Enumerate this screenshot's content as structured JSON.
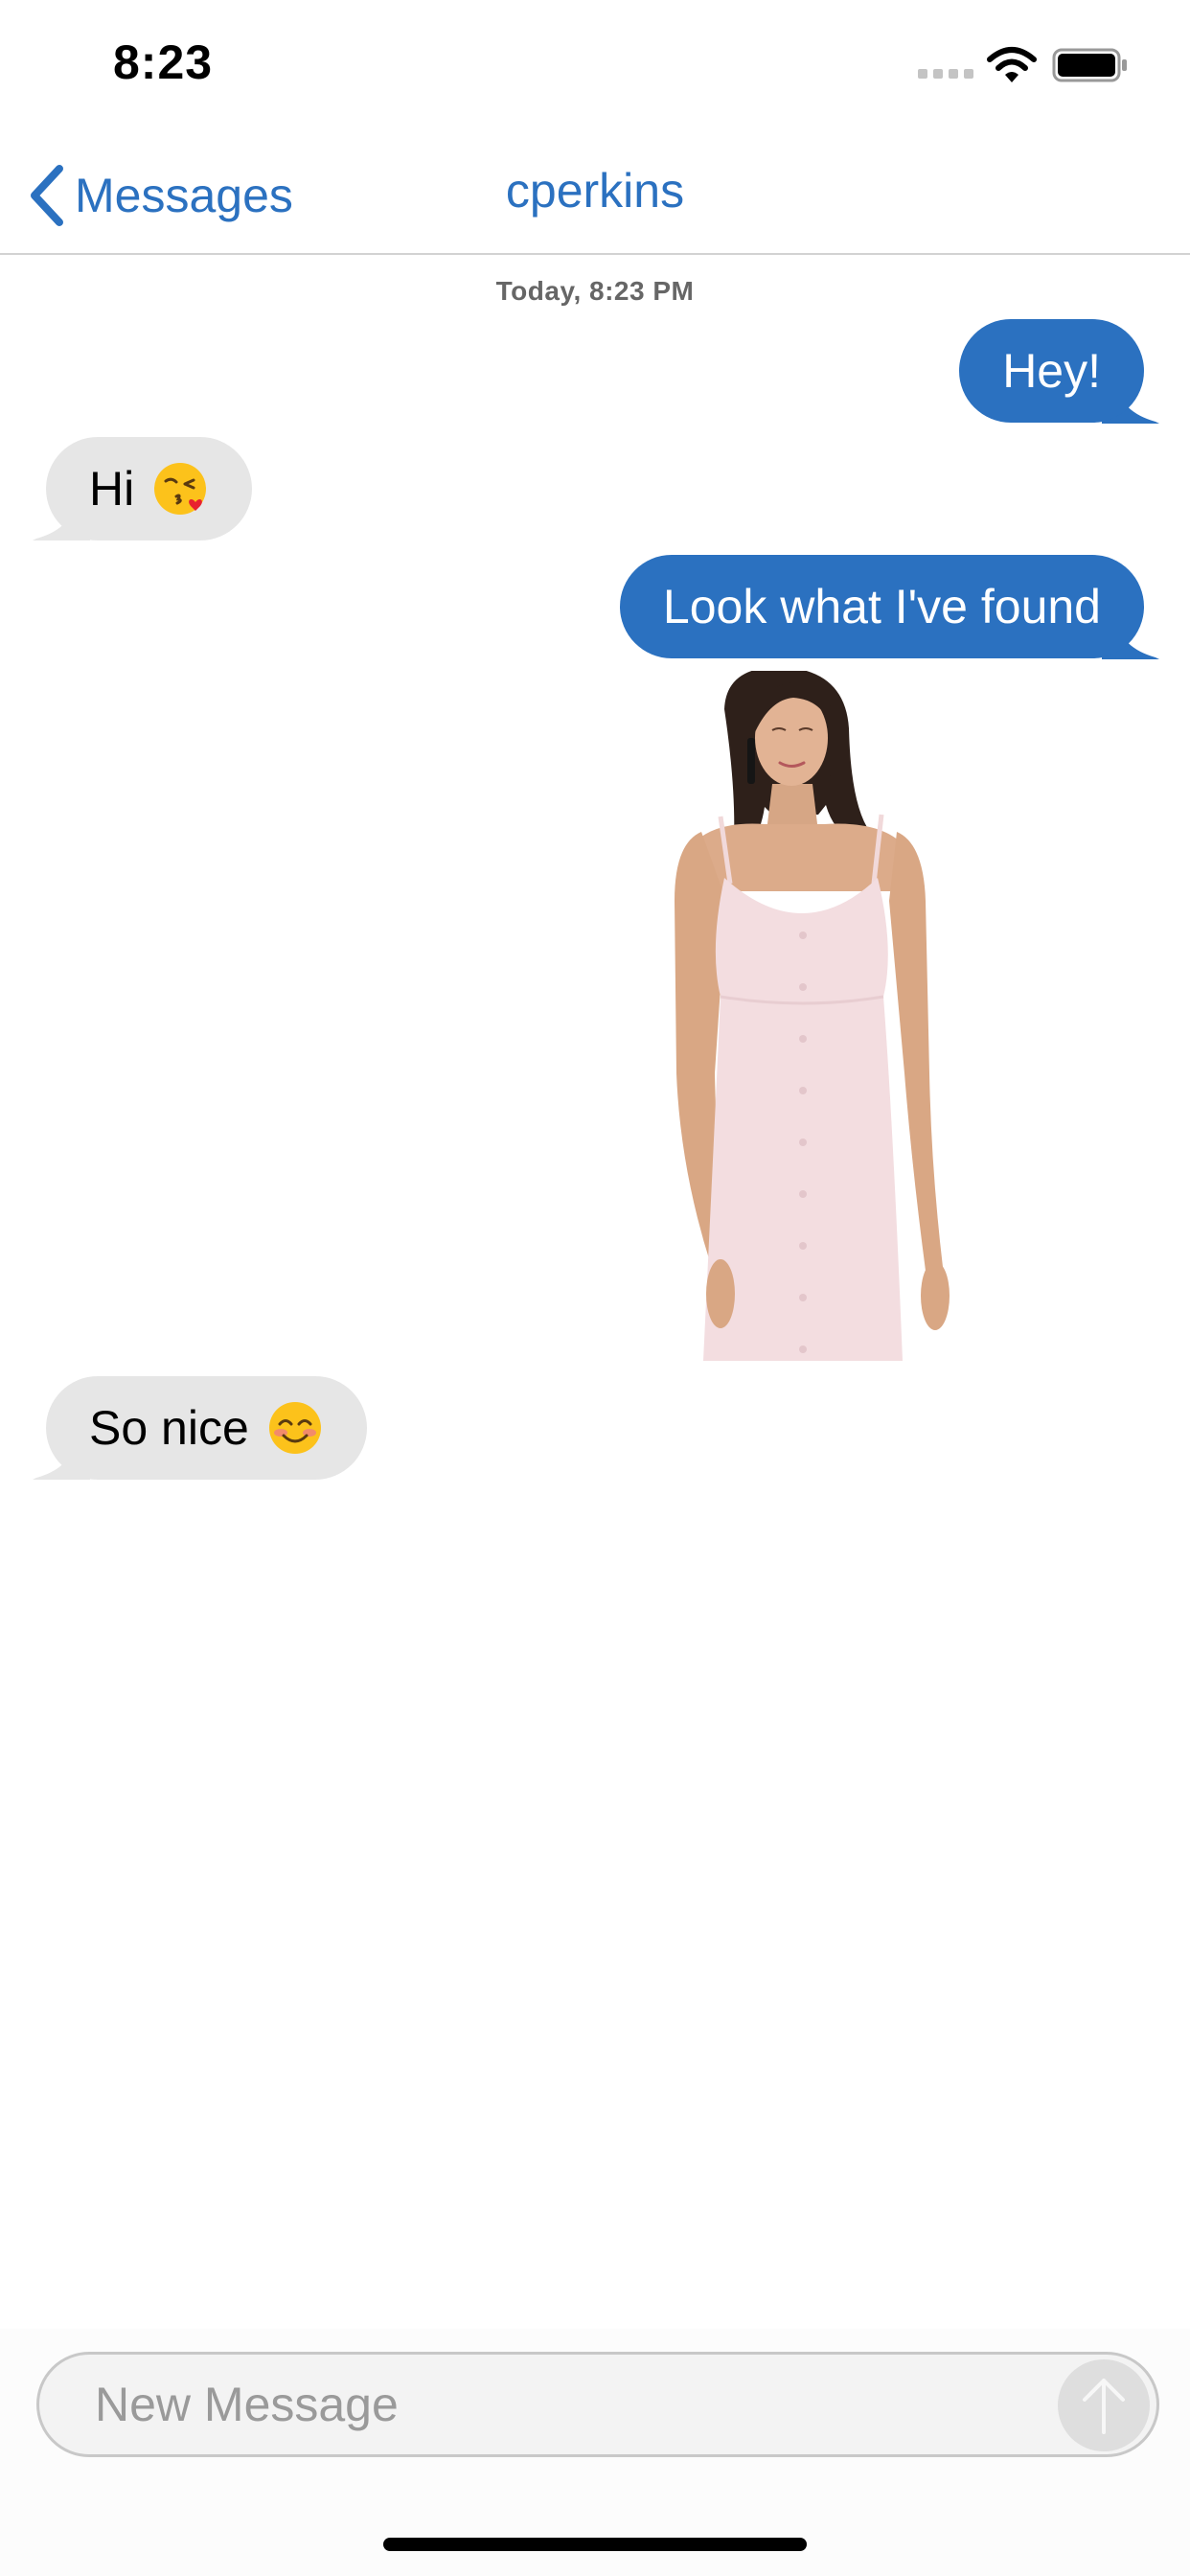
{
  "status_bar": {
    "time": "8:23"
  },
  "nav": {
    "back_label": "Messages",
    "title": "cperkins"
  },
  "conversation": {
    "timestamp": "Today, 8:23 PM",
    "messages": [
      {
        "direction": "outgoing",
        "text": "Hey!"
      },
      {
        "direction": "incoming",
        "text": "Hi",
        "emoji": "kissing-face-heart"
      },
      {
        "direction": "outgoing",
        "text": "Look what I've found"
      },
      {
        "direction": "outgoing",
        "type": "image",
        "image": "photo of a woman in a light pink button-front slip dress"
      },
      {
        "direction": "incoming",
        "text": "So nice",
        "emoji": "smiling-face-blush"
      }
    ]
  },
  "composer": {
    "placeholder": "New Message"
  },
  "colors": {
    "accent": "#2b71c0",
    "incoming_bubble": "#e6e6e6",
    "outgoing_text": "#ffffff",
    "send_button": "#dedede"
  }
}
